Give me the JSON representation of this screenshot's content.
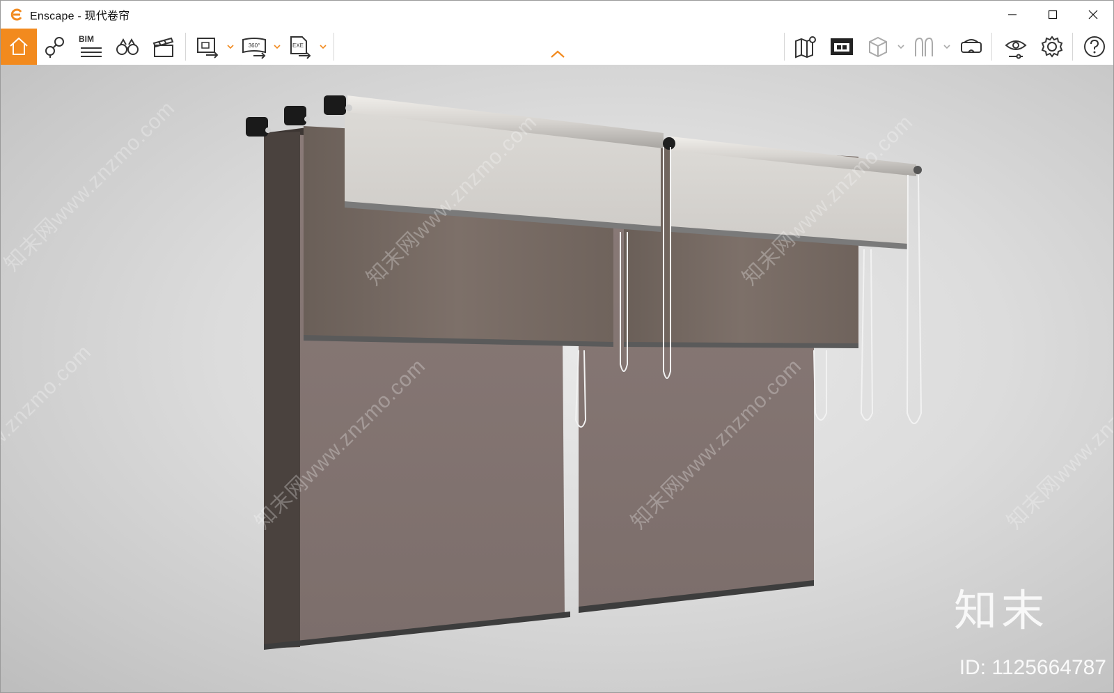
{
  "window": {
    "app_name": "Enscape",
    "separator": " - ",
    "document_name": "现代卷帘"
  },
  "toolbar": {
    "home": "home-icon",
    "bim_label": "BIM",
    "icons": [
      "home-icon",
      "pin-icon",
      "bim-icon",
      "binoculars-icon",
      "clapper-icon",
      "export-image-icon",
      "export-360-icon",
      "export-exe-icon",
      "map-icon",
      "screen-icon",
      "box-icon",
      "compass-icon",
      "vr-headset-icon",
      "eye-settings-icon",
      "gear-icon",
      "help-icon"
    ],
    "pano_label": "360°",
    "exe_label": "EXE"
  },
  "colors": {
    "accent": "#f28a1e",
    "chrome": "#ffffff"
  },
  "watermark": {
    "diag_text": "知末网www.znzmo.com",
    "logo_text": "知末",
    "id_text": "ID: 1125664787"
  }
}
